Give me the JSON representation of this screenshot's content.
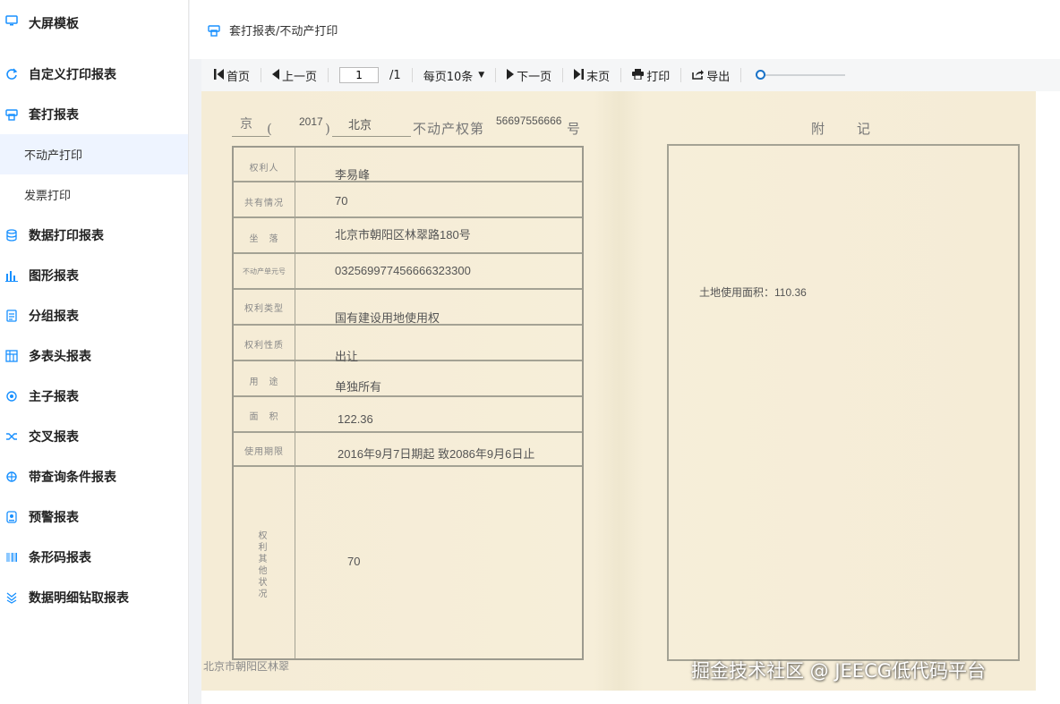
{
  "sidebar": {
    "items": [
      {
        "label": "大屏模板",
        "icon": "monitor-icon"
      },
      {
        "label": "自定义打印报表",
        "icon": "refresh-icon"
      },
      {
        "label": "套打报表",
        "icon": "print-template-icon"
      },
      {
        "label": "不动产打印",
        "sub": true,
        "active": true
      },
      {
        "label": "发票打印",
        "sub": true
      },
      {
        "label": "数据打印报表",
        "icon": "database-icon"
      },
      {
        "label": "图形报表",
        "icon": "bar-chart-icon"
      },
      {
        "label": "分组报表",
        "icon": "group-icon"
      },
      {
        "label": "多表头报表",
        "icon": "multi-header-icon"
      },
      {
        "label": "主子报表",
        "icon": "master-detail-icon"
      },
      {
        "label": "交叉报表",
        "icon": "cross-icon"
      },
      {
        "label": "带查询条件报表",
        "icon": "query-icon"
      },
      {
        "label": "预警报表",
        "icon": "warning-icon"
      },
      {
        "label": "条形码报表",
        "icon": "barcode-icon"
      },
      {
        "label": "数据明细钻取报表",
        "icon": "drilldown-icon"
      }
    ]
  },
  "breadcrumb": "套打报表/不动产打印",
  "toolbar": {
    "first": "首页",
    "prev": "上一页",
    "page_value": "1",
    "page_total": "/1",
    "per_page": "每页10条",
    "next": "下一页",
    "last": "末页",
    "print": "打印",
    "export": "导出",
    "zoom_fraction": 0.0
  },
  "certificate": {
    "prefix": "京",
    "year": "2017",
    "city": "北京",
    "title": "不动产权第",
    "number": "56697556666",
    "suffix": "号",
    "paren_open": "(",
    "paren_close": ")",
    "fields": [
      {
        "label": "权利人",
        "value": "李易峰"
      },
      {
        "label": "共有情况",
        "value": "70"
      },
      {
        "label": "坐　落",
        "value": "北京市朝阳区林翠路180号"
      },
      {
        "label": "不动产单元号",
        "value": "032569977456666323300"
      },
      {
        "label": "权利类型",
        "value": "国有建设用地使用权"
      },
      {
        "label": "权利性质",
        "value": "出让"
      },
      {
        "label": "用　途",
        "value": "单独所有"
      },
      {
        "label": "面　积",
        "value": "122.36"
      },
      {
        "label": "使用期限",
        "value": "2016年9月7日期起 致2086年9月6日止"
      }
    ],
    "other_label": "权利其他状况",
    "other_value": "70",
    "bottom_note": "北京市朝阳区林翠",
    "appendix_title": "附　　记",
    "appendix_text": "土地使用面积：110.36"
  },
  "watermark": "掘金技术社区 @ JEECG低代码平台"
}
